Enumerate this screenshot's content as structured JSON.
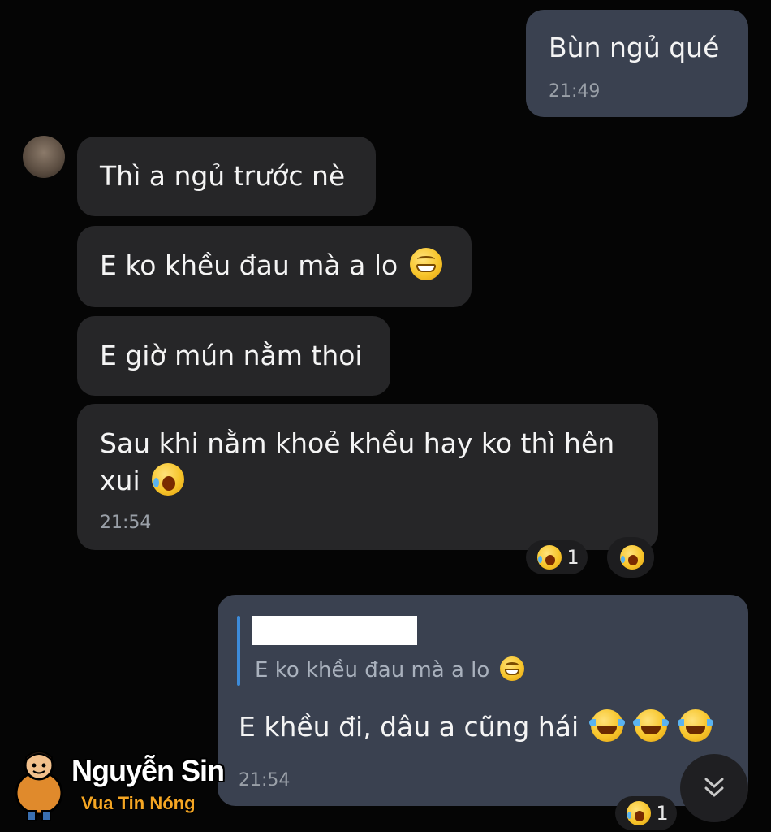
{
  "messages": [
    {
      "id": "m1",
      "direction": "outgoing",
      "text": "Bùn ngủ qué",
      "time": "21:49"
    },
    {
      "id": "m2",
      "direction": "incoming",
      "text": "Thì a ngủ trước nè"
    },
    {
      "id": "m3",
      "direction": "incoming",
      "text": "E ko khều đau mà a lo",
      "emoji": "grin"
    },
    {
      "id": "m4",
      "direction": "incoming",
      "text": "E giờ mún nằm thoi"
    },
    {
      "id": "m5",
      "direction": "incoming",
      "text_line1": "Sau khi nằm khoẻ khều hay ko thì hên",
      "text_line2": "xui",
      "emoji": "scream",
      "time": "21:54",
      "reaction_count": "1"
    },
    {
      "id": "m6",
      "direction": "outgoing",
      "quoted_text": "E ko khều đau mà a lo",
      "text": "E khều đi, dâu a cũng hái",
      "emoji": "joy",
      "time": "21:54",
      "reaction_count": "1"
    }
  ],
  "watermark": {
    "title": "Nguyễn Sin",
    "subtitle": "Vua Tin Nóng"
  },
  "colors": {
    "background": "#050505",
    "incoming_bubble": "#262628",
    "outgoing_bubble": "#3a4150",
    "quote_bar": "#3d8bd9",
    "watermark_accent": "#f5a623"
  },
  "icons": {
    "scroll_down": "double-chevron-down-icon"
  }
}
